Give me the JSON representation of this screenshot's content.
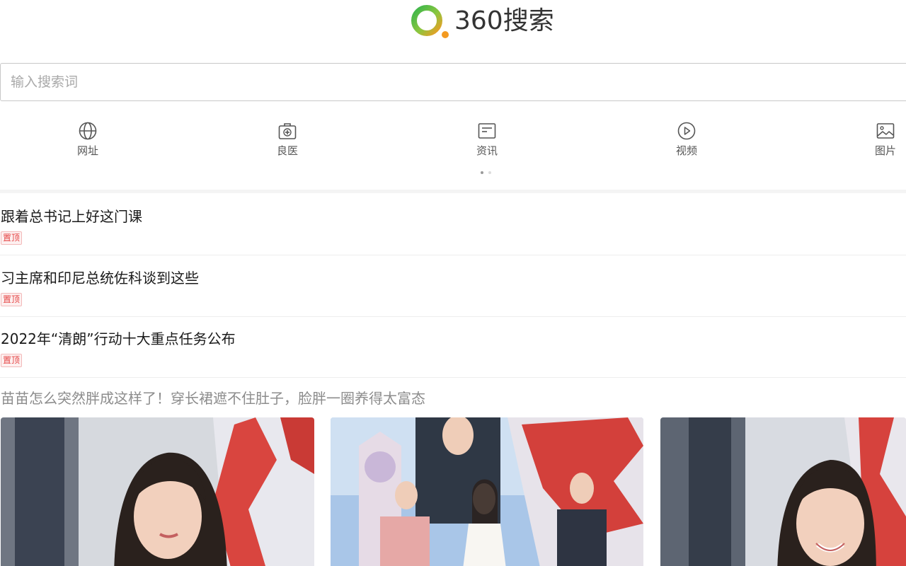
{
  "logo": {
    "text": "360搜索"
  },
  "search": {
    "placeholder": "输入搜索词",
    "value": ""
  },
  "categories": [
    {
      "label": "网址",
      "icon": "globe-icon"
    },
    {
      "label": "良医",
      "icon": "medical-kit-icon"
    },
    {
      "label": "资讯",
      "icon": "news-icon"
    },
    {
      "label": "视频",
      "icon": "play-icon"
    },
    {
      "label": "图片",
      "icon": "image-icon"
    }
  ],
  "pager": {
    "pages": 2,
    "current": 1
  },
  "pinned_news": [
    {
      "title": "跟着总书记上好这门课",
      "badge": "置顶"
    },
    {
      "title": "习主席和印尼总统佐科谈到这些",
      "badge": "置顶"
    },
    {
      "title": "2022年“清朗”行动十大重点任务公布",
      "badge": "置顶"
    }
  ],
  "feed": {
    "title": "苗苗怎么突然胖成这样了！穿长裙遮不住肚子，脸胖一圈养得太富态",
    "thumbnails": [
      "photo-1",
      "photo-2",
      "photo-3"
    ]
  },
  "colors": {
    "logo_green": "#2dae4a",
    "logo_orange": "#f39a21",
    "badge_red": "#e54545"
  }
}
